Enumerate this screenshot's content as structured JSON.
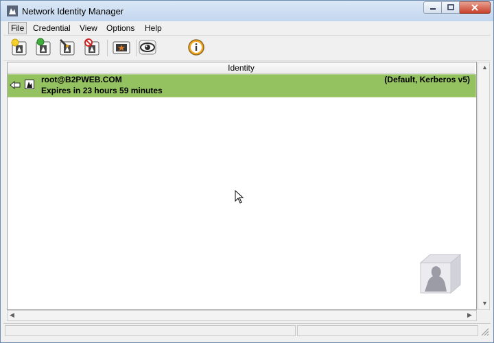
{
  "window": {
    "title": "Network Identity Manager"
  },
  "window_controls": {
    "minimize_icon": "minimize-icon",
    "maximize_icon": "maximize-icon",
    "close_icon": "close-icon"
  },
  "menu": {
    "items": [
      {
        "label": "File",
        "active": true
      },
      {
        "label": "Credential"
      },
      {
        "label": "View"
      },
      {
        "label": "Options"
      },
      {
        "label": "Help"
      }
    ]
  },
  "toolbar": {
    "buttons": [
      {
        "icon": "new-credential-icon"
      },
      {
        "icon": "renew-credential-icon"
      },
      {
        "icon": "import-credential-icon"
      },
      {
        "icon": "destroy-credential-icon"
      },
      {
        "icon": "set-default-icon"
      },
      {
        "icon": "view-eye-icon"
      },
      {
        "icon": "info-icon"
      }
    ]
  },
  "list": {
    "column_header": "Identity",
    "identities": [
      {
        "name": "root@B2PWEB.COM",
        "details": "(Default, Kerberos v5)",
        "expires": "Expires in 23 hours 59 minutes",
        "status_color": "#95c260"
      }
    ]
  },
  "colors": {
    "accent_green": "#95c260",
    "window_bg": "#f0f0f0"
  },
  "statusbar": {
    "panes": [
      "",
      ""
    ]
  }
}
